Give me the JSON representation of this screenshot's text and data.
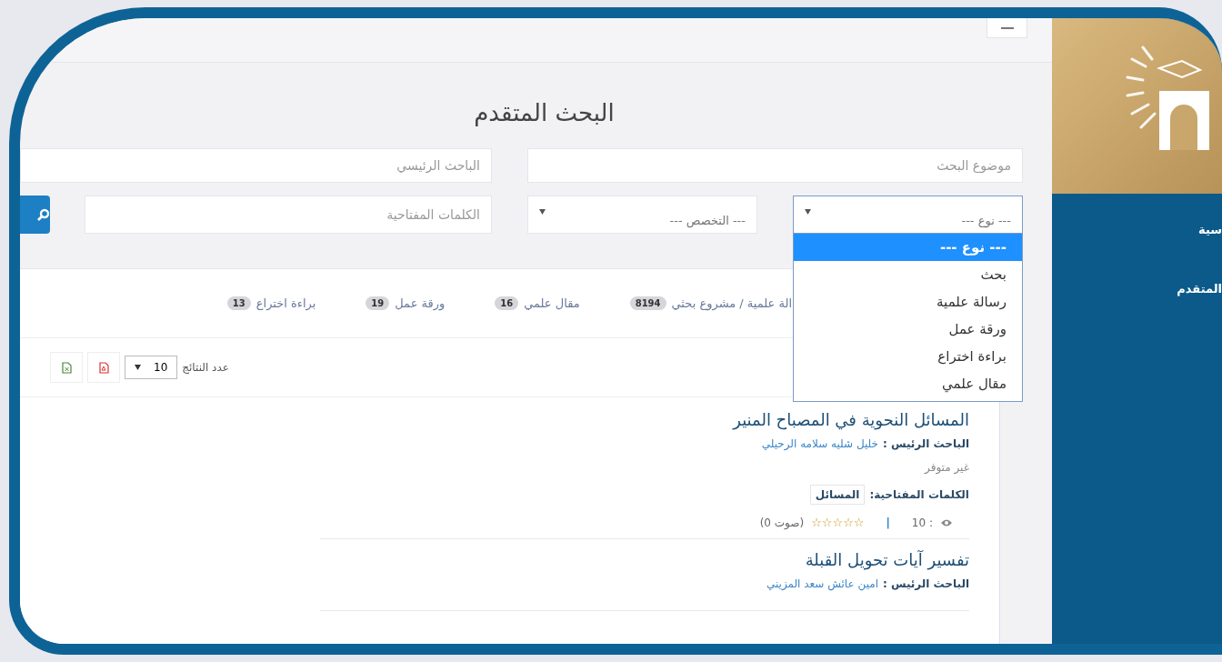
{
  "sidebar": {
    "items": [
      {
        "label": "سية"
      },
      {
        "label": "المتقدم"
      }
    ]
  },
  "page_title": "البحث المتقدم",
  "search_form": {
    "topic_field": {
      "placeholder": "موضوع البحث"
    },
    "researcher_field": {
      "placeholder": "الباحث الرئيسي"
    },
    "type_select": {
      "value": "--- نوع ---",
      "expanded": true,
      "options": [
        {
          "label": "--- نوع ---",
          "selected": true
        },
        {
          "label": "بحث",
          "selected": false
        },
        {
          "label": "رسالة علمية",
          "selected": false
        },
        {
          "label": "ورقة عمل",
          "selected": false
        },
        {
          "label": "براءة اختراع",
          "selected": false
        },
        {
          "label": "مقال علمي",
          "selected": false
        }
      ]
    },
    "specialization_select": {
      "value": "--- التخصص ---"
    },
    "keywords_field": {
      "placeholder": "الكلمات المفتاحية"
    }
  },
  "type_tabs": [
    {
      "label": "الة علمية / مشروع بحثي",
      "count": "8194"
    },
    {
      "label": "مقال علمي",
      "count": "16"
    },
    {
      "label": "ورقة عمل",
      "count": "19"
    },
    {
      "label": "براءة اختراع",
      "count": "13"
    }
  ],
  "results_toolbar": {
    "label": "عدد النتائج",
    "page_size": "10"
  },
  "results": [
    {
      "title": "المسائل النحوية في المصباح المنير",
      "researcher_label": "الباحث الرئيس :",
      "researcher": "خليل شليه سلامه الرحيلي",
      "availability": "غير متوفر",
      "keywords_label": "الكلمات المفتاحية:",
      "keywords": [
        "المسائل"
      ],
      "views": "10 :",
      "separator": "|",
      "stars": 0,
      "votes": "(0 صوت)"
    },
    {
      "title": "تفسير آيات تحويل القبلة",
      "researcher_label": "الباحث الرئيس :",
      "researcher": "امين عائش سعد المزيني"
    }
  ]
}
